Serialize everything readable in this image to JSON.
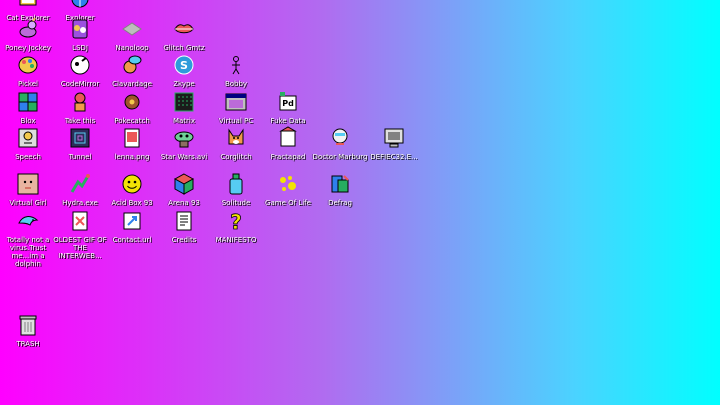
{
  "desktop": {
    "icons": [
      {
        "label": "Cat Explorer"
      },
      {
        "label": "Explorer"
      },
      {
        "label": "Poney Jockey"
      },
      {
        "label": "LSDJ"
      },
      {
        "label": "Nanoloop"
      },
      {
        "label": "Glitch Gmtz"
      },
      {
        "label": "Pickel"
      },
      {
        "label": "CodeMirror"
      },
      {
        "label": "Clavardage"
      },
      {
        "label": "Zkype"
      },
      {
        "label": "Bobby"
      },
      {
        "label": "Blox"
      },
      {
        "label": "Take this"
      },
      {
        "label": "Pokecatch"
      },
      {
        "label": "Matrix"
      },
      {
        "label": "Virtual PC"
      },
      {
        "label": "Fuke Data"
      },
      {
        "label": "Speech"
      },
      {
        "label": "Tunnel"
      },
      {
        "label": "lenna.png"
      },
      {
        "label": "Star Wars.avi"
      },
      {
        "label": "Corglitch"
      },
      {
        "label": "Fractapad"
      },
      {
        "label": "Doctor Marburg"
      },
      {
        "label": "DEFIEC32.E..."
      },
      {
        "label": "Virtual Girl"
      },
      {
        "label": "Hydra.exe"
      },
      {
        "label": "Acid Box 93"
      },
      {
        "label": "Arena 93"
      },
      {
        "label": "Solitude"
      },
      {
        "label": "Game Of Life"
      },
      {
        "label": "Defrag"
      },
      {
        "label": "Totally not a virus.Trust me...im a dolphin"
      },
      {
        "label": "OLDEST GIF OF THE INTERWEB..."
      },
      {
        "label": "Contact.url"
      },
      {
        "label": "Credits"
      },
      {
        "label": "MANIFESTO"
      },
      {
        "label": "TRASH"
      }
    ]
  }
}
